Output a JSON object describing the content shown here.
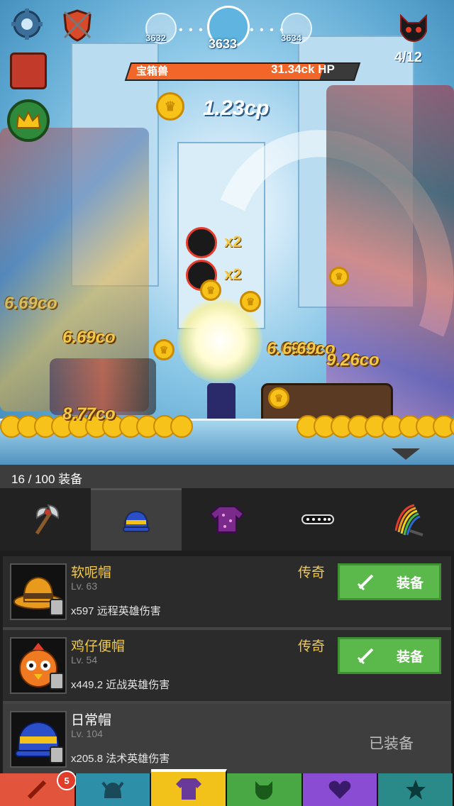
{
  "stage": {
    "prev": "3632",
    "current": "3633",
    "next": "3634",
    "boss_name": "宝箱兽",
    "boss_hp": "31.34ck HP",
    "boss_hp_fraction": 0.85,
    "wave_counter": "4/12"
  },
  "combat": {
    "gold_per_sec": "1.23cp",
    "multiplier_1": "x2",
    "multiplier_2": "x2",
    "damage_texts": [
      "6.69co",
      "6.69co",
      "6.69co",
      "6.69co",
      "9.26co",
      "8.77co"
    ]
  },
  "equipment": {
    "count_label": "16 / 100 装备",
    "tabs": [
      "axe-icon",
      "hat-icon",
      "shirt-icon",
      "necklace-icon",
      "rainbow-weapon-icon"
    ],
    "active_tab": 1,
    "items": [
      {
        "name": "软呢帽",
        "level": "Lv. 63",
        "bonus": "x597 远程英雄伤害",
        "rarity": "传奇",
        "action": "装备",
        "hat_color": "#e79a1c"
      },
      {
        "name": "鸡仔便帽",
        "level": "Lv. 54",
        "bonus": "x449.2 近战英雄伤害",
        "rarity": "传奇",
        "action": "装备",
        "hat_color": "#f07a22"
      },
      {
        "name": "日常帽",
        "level": "Lv. 104",
        "bonus": "x205.8 法术英雄伤害",
        "rarity": "",
        "action": "已装备",
        "hat_color": "#2a4fc9"
      }
    ]
  },
  "bottom_nav": {
    "badge": "5",
    "colors": [
      "#e2553c",
      "#2d8fa8",
      "#f2c21a",
      "#4aa844",
      "#8a4cd2",
      "#2a8a8a"
    ],
    "icons": [
      "sword-icon",
      "helmet-icon",
      "shirt-icon",
      "demon-icon",
      "heart-icon",
      "star-icon"
    ]
  },
  "colors": {
    "equip_button": "#5bb84a",
    "rarity": "#f3c94a",
    "hp_fill": "#f2662a"
  }
}
